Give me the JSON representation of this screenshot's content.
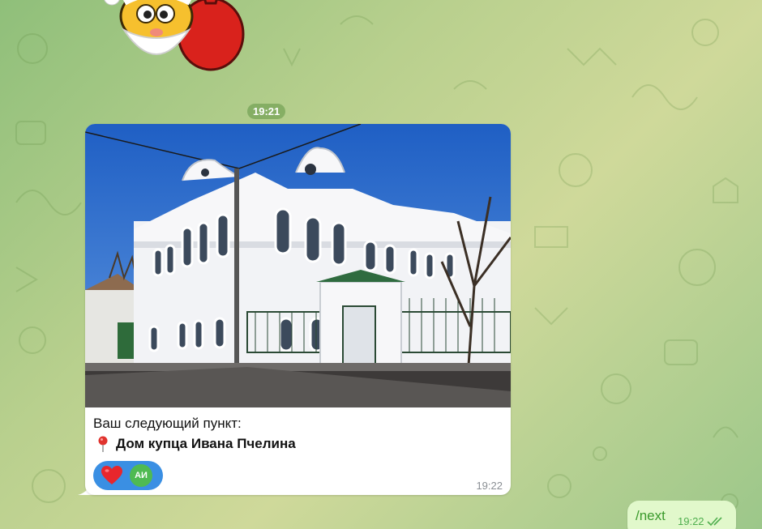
{
  "time_divider": "19:21",
  "incoming_message": {
    "caption_line1": "Ваш следующий пункт:",
    "caption_line2": "Дом купца Ивана Пчелина",
    "pin_icon": "round-pushpin-icon",
    "reaction": {
      "emoji_icon": "red-heart-icon",
      "avatar_initials": "АИ"
    },
    "time": "19:22"
  },
  "outgoing_message": {
    "text": "/next",
    "time": "19:22",
    "status_icon": "double-check-icon"
  },
  "colors": {
    "reaction_bg": "#3a8fe3",
    "outgoing_bg": "#e1f8cb",
    "avatar_bg": "#4fba52"
  }
}
